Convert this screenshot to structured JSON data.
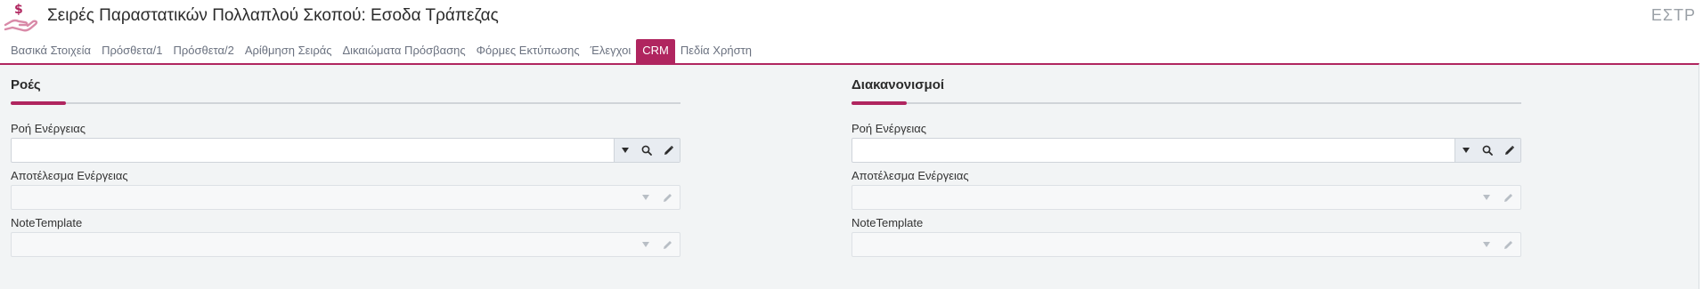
{
  "header": {
    "title": "Σειρές Παραστατικών Πολλαπλού Σκοπού: Εσοδα Τράπεζας",
    "code": "ΕΣΤΡ",
    "icon": "hand-money-icon",
    "accent_color": "#b0255f"
  },
  "tabs": [
    {
      "label": "Βασικά Στοιχεία",
      "active": false
    },
    {
      "label": "Πρόσθετα/1",
      "active": false
    },
    {
      "label": "Πρόσθετα/2",
      "active": false
    },
    {
      "label": "Αρίθμηση Σειράς",
      "active": false
    },
    {
      "label": "Δικαιώματα Πρόσβασης",
      "active": false
    },
    {
      "label": "Φόρμες Εκτύπωσης",
      "active": false
    },
    {
      "label": "Έλεγχοι",
      "active": false
    },
    {
      "label": "CRM",
      "active": true
    },
    {
      "label": "Πεδία Χρήστη",
      "active": false
    }
  ],
  "sections": {
    "left": {
      "title": "Ροές",
      "fields": [
        {
          "label": "Ροή Ενέργειας",
          "value": "",
          "enabled": true
        },
        {
          "label": "Αποτέλεσμα Ενέργειας",
          "value": "",
          "enabled": false
        },
        {
          "label": "NoteTemplate",
          "value": "",
          "enabled": false
        }
      ]
    },
    "right": {
      "title": "Διακανονισμοί",
      "fields": [
        {
          "label": "Ροή Ενέργειας",
          "value": "",
          "enabled": true
        },
        {
          "label": "Αποτέλεσμα Ενέργειας",
          "value": "",
          "enabled": false
        },
        {
          "label": "NoteTemplate",
          "value": "",
          "enabled": false
        }
      ]
    }
  },
  "icons": {
    "dropdown": "chevron-down-icon",
    "search": "search-icon",
    "edit": "pencil-icon"
  }
}
